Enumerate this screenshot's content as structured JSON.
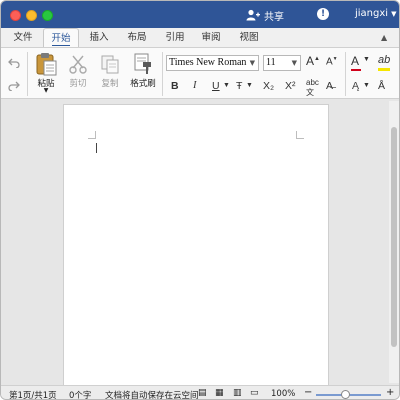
{
  "titlebar": {
    "share_label": "共享",
    "user_name": "jiangxi"
  },
  "tabs": [
    {
      "label": "文件"
    },
    {
      "label": "开始",
      "active": true
    },
    {
      "label": "插入"
    },
    {
      "label": "布局"
    },
    {
      "label": "引用"
    },
    {
      "label": "审阅"
    },
    {
      "label": "视图"
    }
  ],
  "ribbon": {
    "paste_label": "粘贴",
    "cut_label": "剪切",
    "copy_label": "复制",
    "format_painter_label": "格式刷",
    "font_name": "Times New Roman",
    "font_size": "11",
    "bold": "B",
    "italic": "I",
    "underline": "U",
    "strikethrough": "Ŧ",
    "subscript": "X₂",
    "superscript": "X²",
    "accent_color": "#2b579a",
    "font_color": "#d0021b",
    "highlight_color": "#f6e600"
  },
  "status": {
    "page_info": "第1页/共1页",
    "word_count": "0个字",
    "autosave": "文档将自动保存在云空间",
    "zoom": "100%"
  },
  "icons": [
    "undo-icon",
    "redo-icon",
    "paste-icon",
    "scissors-icon",
    "copy-icon",
    "format-painter-icon",
    "share-person-icon",
    "info-icon"
  ]
}
